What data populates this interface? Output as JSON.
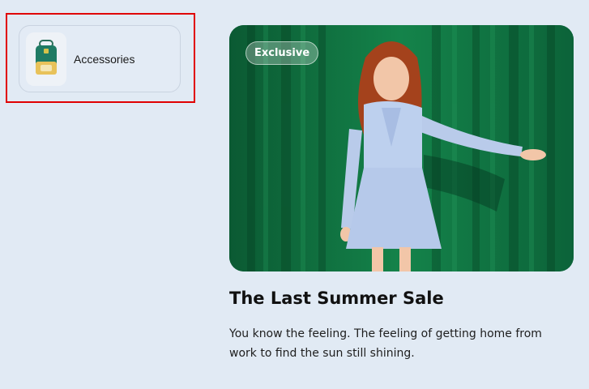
{
  "category": {
    "label": "Accessories",
    "thumbnail_icon": "backpack-icon"
  },
  "promo": {
    "badge": "Exclusive",
    "title": "The Last Summer Sale",
    "description": "You know the feeling. The feeling of getting home from work to find the sun still shining."
  },
  "colors": {
    "background": "#e1eaf4",
    "curtain": "#0f6a3d",
    "highlight": "#e00000"
  }
}
